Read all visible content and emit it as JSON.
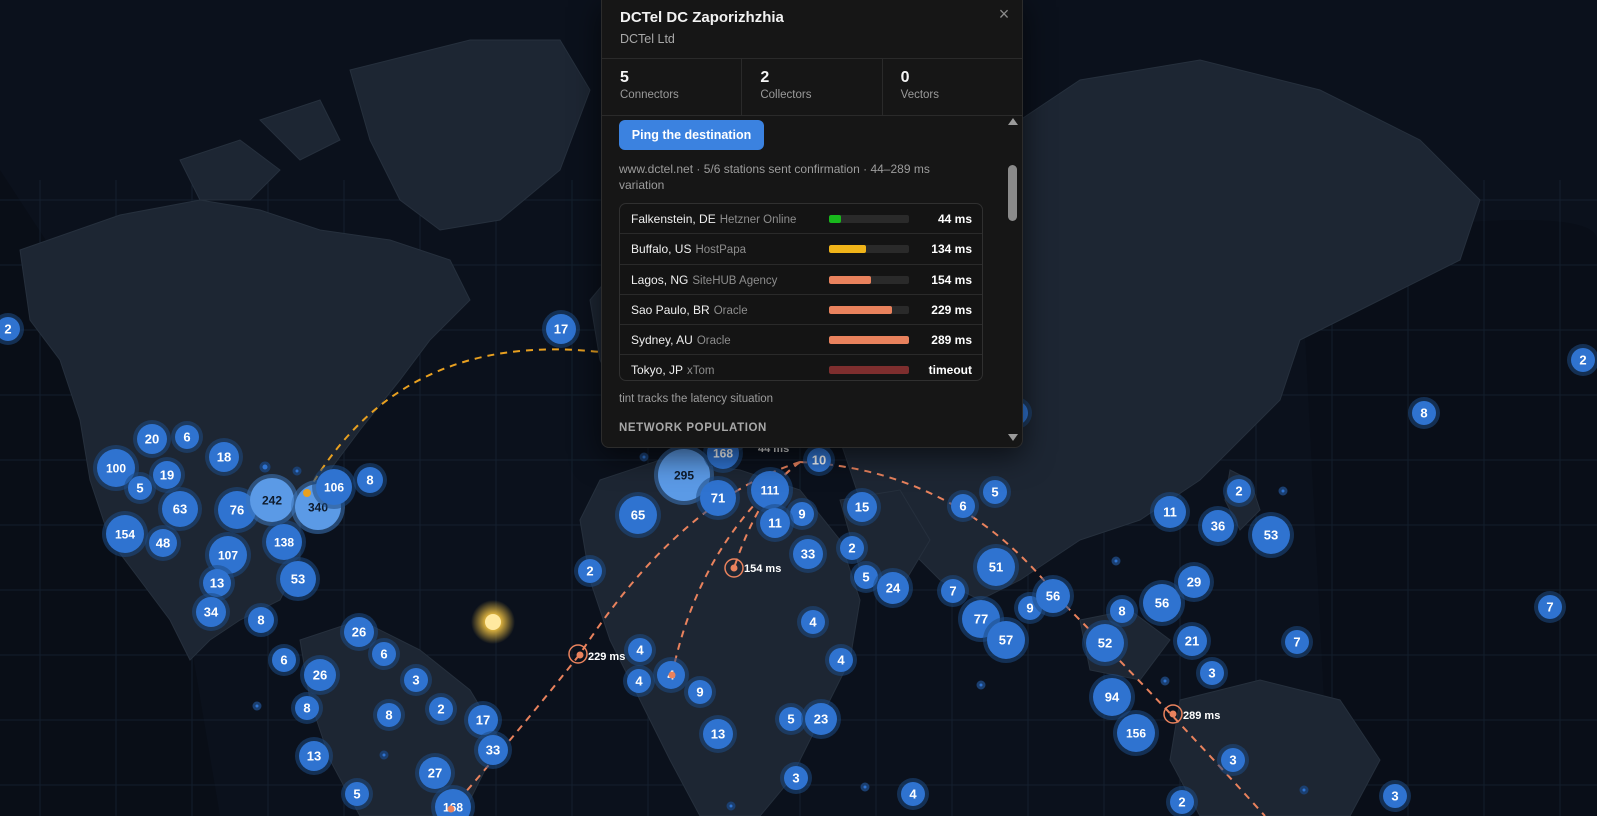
{
  "popup": {
    "title": "DCTel DC Zaporizhzhia",
    "subtitle": "DCTel Ltd",
    "close_label": "×",
    "stats": [
      {
        "value": "5",
        "label": "Connectors"
      },
      {
        "value": "2",
        "label": "Collectors"
      },
      {
        "value": "0",
        "label": "Vectors"
      }
    ],
    "ping_button": "Ping the destination",
    "ping_description": "www.dctel.net · 5/6 stations sent confirmation · 44–289 ms variation",
    "ping_results": [
      {
        "location": "Falkenstein, DE",
        "provider": "Hetzner Online",
        "ms": "44 ms",
        "level": 0.15,
        "color": "#18b81c"
      },
      {
        "location": "Buffalo, US",
        "provider": "HostPapa",
        "ms": "134 ms",
        "level": 0.46,
        "color": "#f0b419"
      },
      {
        "location": "Lagos, NG",
        "provider": "SiteHUB Agency",
        "ms": "154 ms",
        "level": 0.53,
        "color": "#e9825d"
      },
      {
        "location": "Sao Paulo, BR",
        "provider": "Oracle",
        "ms": "229 ms",
        "level": 0.79,
        "color": "#e9825d"
      },
      {
        "location": "Sydney, AU",
        "provider": "Oracle",
        "ms": "289 ms",
        "level": 1.0,
        "color": "#e9825d"
      },
      {
        "location": "Tokyo, JP",
        "provider": "xTom",
        "ms": "timeout",
        "level": 1.0,
        "color": "#7e2e2e"
      }
    ],
    "tint_note": "tint tracks the latency situation",
    "section_title": "NETWORK POPULATION"
  },
  "map": {
    "route_labels": [
      {
        "text": "154 ms"
      },
      {
        "text": "229 ms"
      },
      {
        "text": "289 ms"
      },
      {
        "text": "44 ms"
      }
    ],
    "clusters": [
      "2",
      "2",
      "17",
      "20",
      "6",
      "100",
      "19",
      "18",
      "5",
      "63",
      "76",
      "242",
      "340",
      "106",
      "8",
      "154",
      "48",
      "107",
      "138",
      "13",
      "53",
      "34",
      "8",
      "26",
      "6",
      "6",
      "26",
      "3",
      "8",
      "8",
      "2",
      "17",
      "33",
      "13",
      "27",
      "5",
      "168",
      "2",
      "65",
      "295",
      "168",
      "71",
      "111",
      "10",
      "9",
      "11",
      "15",
      "6",
      "5",
      "33",
      "2",
      "5",
      "24",
      "51",
      "7",
      "77",
      "57",
      "9",
      "56",
      "8",
      "56",
      "52",
      "29",
      "11",
      "36",
      "53",
      "2",
      "21",
      "7",
      "3",
      "94",
      "156",
      "3",
      "7",
      "3",
      "2",
      "4",
      "4",
      "4",
      "4",
      "9",
      "4",
      "13",
      "5",
      "23",
      "3",
      "4",
      "8",
      "3"
    ]
  },
  "colors": {
    "accent": "#3b82e0",
    "cluster": "#2f73d0",
    "cluster_light": "#5b9ae6",
    "route_orange": "#e9825d",
    "route_yellow": "#e8a020",
    "background": "#0b111c"
  }
}
